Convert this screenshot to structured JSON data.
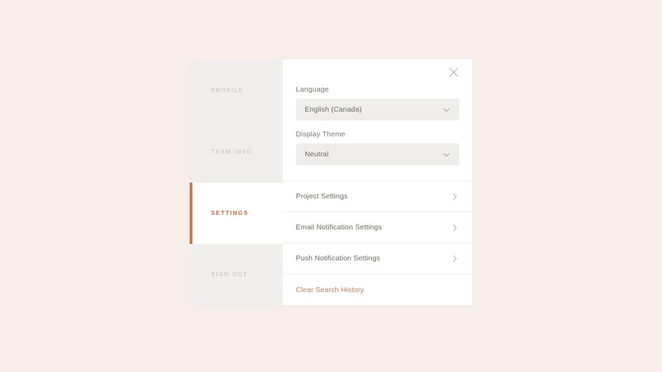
{
  "theme": {
    "page_background": "#f7eeea",
    "card_background": "#ffffff",
    "sidebar_inactive_background": "#f0efee",
    "accent": "#c87a52",
    "accent_text": "#c06b4a",
    "link_accent": "#ca7a4e",
    "muted_text": "#c3bdba",
    "body_text": "#6f6762",
    "field_background": "#efeeed"
  },
  "sidebar": {
    "items": [
      {
        "label": "PROFILE",
        "active": false,
        "icon": ""
      },
      {
        "label": "TEAM INFO",
        "active": false,
        "icon": ""
      },
      {
        "label": "SETTINGS",
        "active": true,
        "icon": ""
      },
      {
        "label": "SIGN OUT",
        "active": false,
        "icon": ""
      }
    ]
  },
  "panel": {
    "close_icon": "close-icon",
    "fields": [
      {
        "label": "Language",
        "value": "English (Canada)",
        "icon": "chevron-down-icon"
      },
      {
        "label": "Display Theme",
        "value": "Neutral",
        "icon": "chevron-down-icon"
      }
    ],
    "rows": [
      {
        "label": "Project Settings",
        "icon": "chevron-right-icon",
        "accent": false
      },
      {
        "label": "Email Notification Settings",
        "icon": "chevron-right-icon",
        "accent": false
      },
      {
        "label": "Push Notification Settings",
        "icon": "chevron-right-icon",
        "accent": false
      },
      {
        "label": "Clear Search History",
        "icon": "",
        "accent": true
      }
    ]
  }
}
